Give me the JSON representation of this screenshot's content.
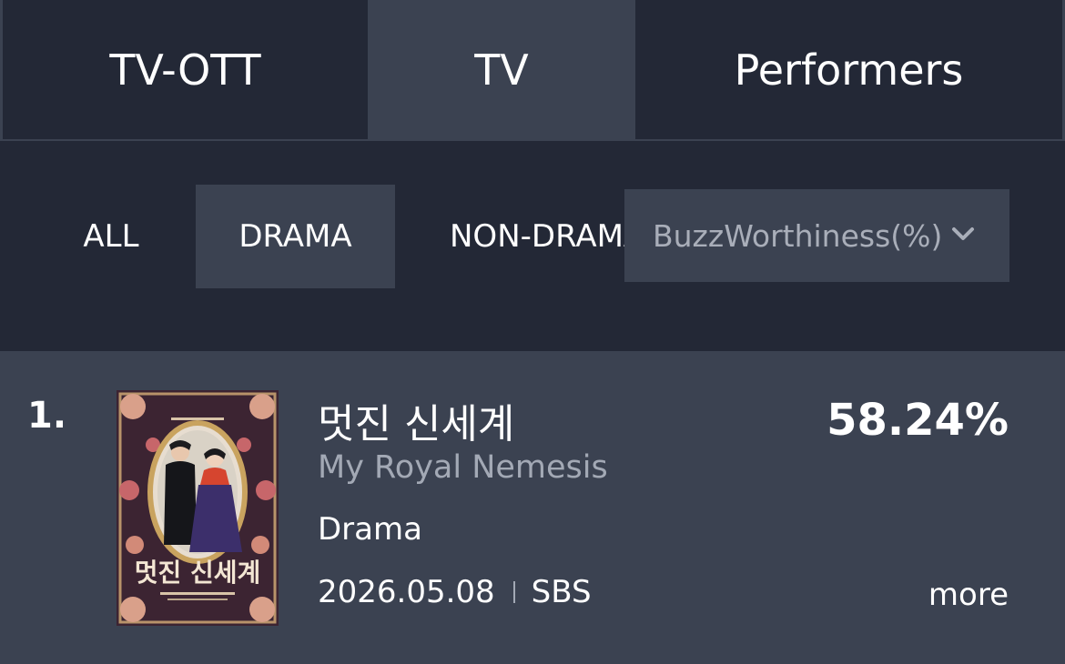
{
  "tabs": [
    {
      "label": "TV-OTT"
    },
    {
      "label": "TV"
    },
    {
      "label": "Performers"
    }
  ],
  "filters": {
    "chips": [
      "ALL",
      "DRAMA",
      "NON-DRAMA"
    ],
    "selected": "DRAMA",
    "sort_select": {
      "value": "BuzzWorthiness(%)",
      "icon": "chevron-down-icon"
    }
  },
  "ranking": [
    {
      "rank": "1.",
      "title_ko": "멋진 신세계",
      "title_en": "My Royal Nemesis",
      "genre": "Drama",
      "date": "2026.05.08",
      "channel": "SBS",
      "percent": "58.24%",
      "more_label": "more",
      "poster_text": "멋진 신세계"
    }
  ],
  "colors": {
    "background": "#232836",
    "panel": "#3b4251",
    "muted_text": "#a3a9b5"
  }
}
